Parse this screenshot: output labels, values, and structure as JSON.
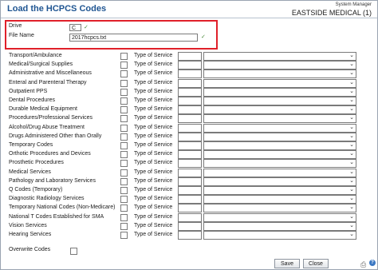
{
  "header": {
    "title": "Load the HCPCS Codes",
    "system_manager": "System Manager",
    "company": "EASTSIDE MEDICAL (1)"
  },
  "form": {
    "drive_label": "Drive",
    "drive_value": "C",
    "file_name_label": "File Name",
    "file_name_value": "2017hcpcs.txt",
    "check_glyph": "✓"
  },
  "service_type_label": "Type of Service",
  "rows": [
    {
      "label": "Transport/Ambulance"
    },
    {
      "label": "Medical/Surgical Supplies"
    },
    {
      "label": "Administrative and Miscellaneous"
    },
    {
      "label": "Enteral and Parenteral Therapy"
    },
    {
      "label": "Outpatient PPS"
    },
    {
      "label": "Dental Procedures"
    },
    {
      "label": "Durable Medical Equipment"
    },
    {
      "label": "Procedures/Professional Services"
    },
    {
      "label": "Alcohol/Drug Abuse Treatment"
    },
    {
      "label": "Drugs Administered Other than Orally"
    },
    {
      "label": "Temporary Codes"
    },
    {
      "label": "Orthotic Procedures and Devices"
    },
    {
      "label": "Prosthetic Procedures"
    },
    {
      "label": "Medical Services"
    },
    {
      "label": "Pathology and Laboratory Services"
    },
    {
      "label": "Q Codes (Temporary)"
    },
    {
      "label": "Diagnostic Radiology Services"
    },
    {
      "label": "Temporary National Codes (Non-Medicare)"
    },
    {
      "label": "National T Codes Established for SMA"
    },
    {
      "label": "Vision Services"
    },
    {
      "label": "Hearing Services"
    }
  ],
  "overwrite_label": "Overwrite Codes",
  "buttons": {
    "save": "Save",
    "close": "Close"
  },
  "icons": {
    "dropdown": "chevron-down-icon",
    "print": "printer-icon",
    "help": "help-icon"
  },
  "colors": {
    "title": "#1f5592",
    "highlight_border": "#e0202a",
    "check": "#4a8a3a"
  }
}
